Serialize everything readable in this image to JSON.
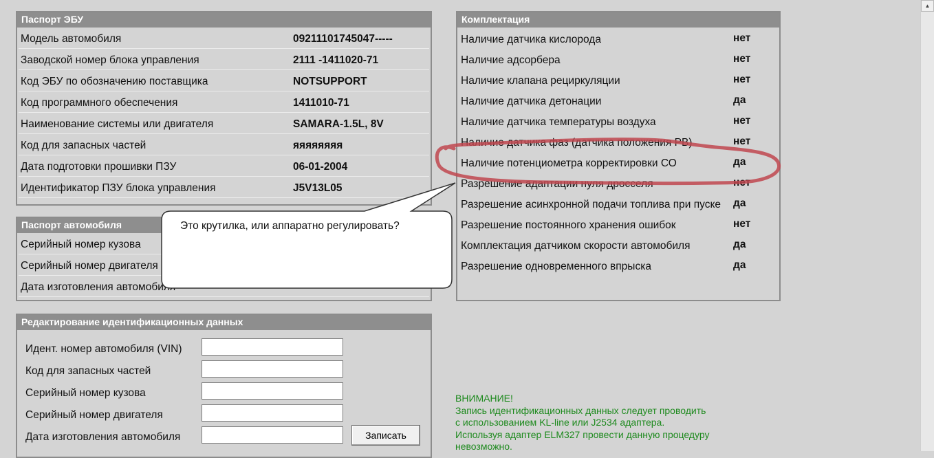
{
  "ecu_passport": {
    "title": "Паспорт ЭБУ",
    "rows": [
      {
        "label": "Модель автомобиля",
        "value": "09211101745047-----"
      },
      {
        "label": "Заводской номер блока управления",
        "value": "2111 -1411020-71"
      },
      {
        "label": "Код ЭБУ по обозначению поставщика",
        "value": "NOTSUPPORT"
      },
      {
        "label": "Код программного обеспечения",
        "value": "1411010-71"
      },
      {
        "label": "Наименование системы или двигателя",
        "value": "SAMARA-1.5L, 8V"
      },
      {
        "label": "Код для запасных частей",
        "value": "яяяяяяяя"
      },
      {
        "label": "Дата подготовки прошивки ПЗУ",
        "value": "06-01-2004"
      },
      {
        "label": "Идентификатор ПЗУ блока управления",
        "value": "J5V13L05"
      }
    ]
  },
  "car_passport": {
    "title": "Паспорт автомобиля",
    "rows": [
      {
        "label": "Серийный номер кузова"
      },
      {
        "label": "Серийный номер двигателя"
      },
      {
        "label": "Дата изготовления автомобиля"
      }
    ]
  },
  "equipment": {
    "title": "Комплектация",
    "rows": [
      {
        "label": "Наличие датчика кислорода",
        "value": "нет"
      },
      {
        "label": "Наличие адсорбера",
        "value": "нет"
      },
      {
        "label": "Наличие клапана рециркуляции",
        "value": "нет"
      },
      {
        "label": "Наличие датчика детонации",
        "value": "да"
      },
      {
        "label": "Наличие датчика температуры воздуха",
        "value": "нет"
      },
      {
        "label": "Наличие датчика фаз (датчика положения РВ)",
        "value": "нет"
      },
      {
        "label": "Наличие потенциометра корректировки СО",
        "value": "да"
      },
      {
        "label": "Разрешение адаптации нуля дросселя",
        "value": "нет"
      },
      {
        "label": "Разрешение асинхронной подачи топлива при пуске",
        "value": "да"
      },
      {
        "label": "Разрешение постоянного хранения ошибок",
        "value": "нет"
      },
      {
        "label": "Комплектация датчиком скорости автомобиля",
        "value": "да"
      },
      {
        "label": "Разрешение одновременного впрыска",
        "value": "да"
      }
    ]
  },
  "edit_form": {
    "title": "Редактирование идентификационных данных",
    "fields": [
      {
        "label": "Идент. номер автомобиля (VIN)",
        "value": ""
      },
      {
        "label": "Код для запасных частей",
        "value": ""
      },
      {
        "label": "Серийный номер кузова",
        "value": ""
      },
      {
        "label": "Серийный номер двигателя",
        "value": ""
      },
      {
        "label": "Дата изготовления автомобиля",
        "value": ""
      }
    ],
    "submit_label": "Записать"
  },
  "warning": {
    "lines": [
      "ВНИМАНИЕ!",
      "Запись идентификационных данных следует проводить",
      "с использованием KL-line или J2534 адаптера.",
      "Используя адаптер ELM327 провести данную процедуру",
      "невозможно."
    ]
  },
  "callout": {
    "text": "Это крутилка, или аппаратно регулировать?"
  },
  "colors": {
    "background": "#d4d4d4",
    "panel_header": "#8e8e8e",
    "warning_text": "#1e8a1e",
    "annotation_mark": "#c0474f"
  },
  "icons": {
    "scroll_up": "scroll-up-arrow"
  }
}
